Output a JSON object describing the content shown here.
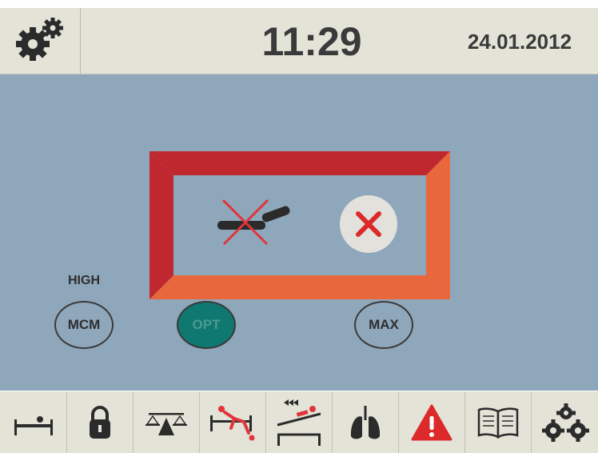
{
  "header": {
    "time": "11:29",
    "date": "24.01.2012",
    "settings_icon": "gears-icon"
  },
  "alert": {
    "frame_color_top": "#c0282f",
    "frame_color_bottom": "#e8673d",
    "symbol_icon": "bed-position-crossed-icon",
    "close_icon": "close-x-icon"
  },
  "modes": {
    "level_label": "HIGH",
    "mcm": "MCM",
    "opt": "OPT",
    "max": "MAX",
    "active_color": "#0f7870"
  },
  "toolbar": {
    "items": [
      {
        "icon": "bed-flat-icon"
      },
      {
        "icon": "lock-icon"
      },
      {
        "icon": "scale-icon"
      },
      {
        "icon": "patient-fall-icon"
      },
      {
        "icon": "trendelenburg-icon"
      },
      {
        "icon": "lungs-icon"
      },
      {
        "icon": "warning-icon"
      },
      {
        "icon": "manual-book-icon"
      },
      {
        "icon": "settings-gears-icon"
      }
    ]
  }
}
